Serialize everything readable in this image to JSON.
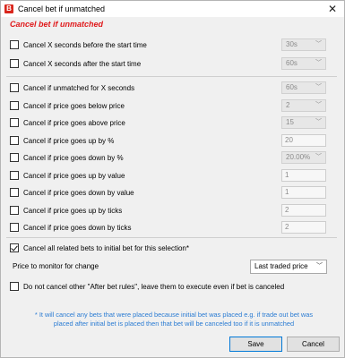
{
  "window": {
    "title": "Cancel bet if unmatched",
    "logo_letter": "B",
    "logo_color": "#d9261c",
    "close_glyph": "✕"
  },
  "section": {
    "header": "Cancel bet if unmatched",
    "header_color": "#e0191b"
  },
  "rules": [
    {
      "label": "Cancel X seconds before the start time",
      "checked": false,
      "control": "select",
      "value": "30s"
    },
    {
      "label": "Cancel X seconds after the start time",
      "checked": false,
      "control": "select",
      "value": "60s"
    },
    {
      "label": "Cancel if unmatched for  X seconds",
      "checked": false,
      "control": "select",
      "value": "60s"
    },
    {
      "label": "Cancel if price goes below price",
      "checked": false,
      "control": "select",
      "value": "2"
    },
    {
      "label": "Cancel if price goes above price",
      "checked": false,
      "control": "select",
      "value": "15"
    },
    {
      "label": "Cancel if price goes up by %",
      "checked": false,
      "control": "text",
      "value": "20"
    },
    {
      "label": "Cancel if price goes down by %",
      "checked": false,
      "control": "select",
      "value": "20.00%"
    },
    {
      "label": "Cancel if price goes up by value",
      "checked": false,
      "control": "text",
      "value": "1"
    },
    {
      "label": "Cancel if price goes down by value",
      "checked": false,
      "control": "text",
      "value": "1"
    },
    {
      "label": "Cancel if price goes up by ticks",
      "checked": false,
      "control": "text",
      "value": "2"
    },
    {
      "label": "Cancel if price goes down by ticks",
      "checked": false,
      "control": "text",
      "value": "2"
    }
  ],
  "related": {
    "label": "Cancel all related bets to initial bet for this selection*",
    "checked": true
  },
  "monitor": {
    "label": "Price to monitor for change",
    "value": "Last traded price"
  },
  "after_bet": {
    "label": "Do not cancel other \"After bet rules\", leave them to execute even if bet is canceled",
    "checked": false
  },
  "note": {
    "line1": "* It will cancel any bets that were placed because initial bet was placed e.g. if trade out bet was",
    "line2": "placed after initial bet is placed then that bet will be canceled too if it is unmatched",
    "color": "#2b7cd3"
  },
  "buttons": {
    "save": "Save",
    "cancel": "Cancel"
  }
}
